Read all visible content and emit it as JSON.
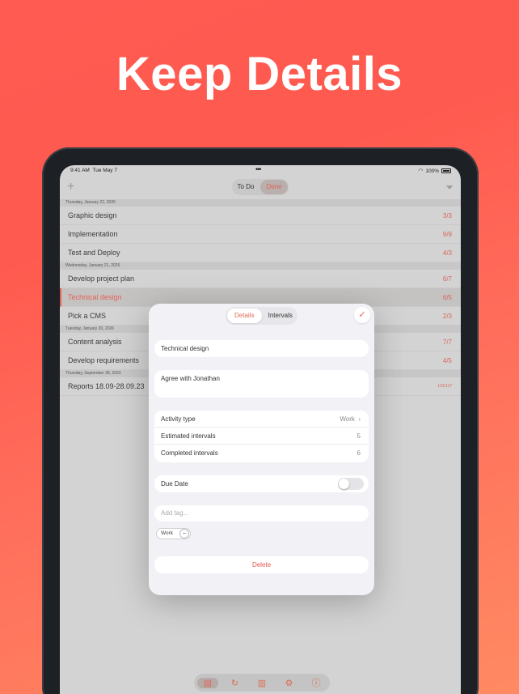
{
  "headline": "Keep Details",
  "status": {
    "time": "9:41 AM",
    "date": "Tue May 7",
    "battery": "100%"
  },
  "toolbar": {
    "segments": [
      "To Do",
      "Done"
    ],
    "selected": "Done"
  },
  "list": {
    "sections": [
      {
        "header": "Thursday, January 22, 2026",
        "rows": [
          {
            "title": "Graphic design",
            "count": "3/3"
          },
          {
            "title": "Implementation",
            "count": "9/9"
          },
          {
            "title": "Test and Deploy",
            "count": "4/3"
          }
        ]
      },
      {
        "header": "Wednesday, January 21, 2026",
        "rows": [
          {
            "title": "Develop project plan",
            "count": "6/7"
          },
          {
            "title": "Technical design",
            "count": "6/5"
          },
          {
            "title": "Pick a CMS",
            "count": "2/3"
          }
        ]
      },
      {
        "header": "Tuesday, January 20, 2026",
        "rows": [
          {
            "title": "Content analysis",
            "count": "7/7"
          },
          {
            "title": "Develop requirements",
            "count": "4/5"
          }
        ]
      },
      {
        "header": "Thursday, September 28, 2023",
        "rows": [
          {
            "title": "Reports 18.09-28.09.23",
            "count": "131/117"
          }
        ]
      }
    ]
  },
  "modal": {
    "tabs": [
      "Details",
      "Intervals"
    ],
    "selected_tab": "Details",
    "title_value": "Technical design",
    "note_value": "Agree with Jonathan",
    "activity_type_label": "Activity type",
    "activity_type_value": "Work",
    "estimated_label": "Estimated intervals",
    "estimated_value": "5",
    "completed_label": "Completed intervals",
    "completed_value": "6",
    "due_date_label": "Due Date",
    "tag_placeholder": "Add tag...",
    "tag": "Work",
    "delete_label": "Delete"
  },
  "colors": {
    "accent": "#e06a55",
    "background": "#ff5b52"
  }
}
